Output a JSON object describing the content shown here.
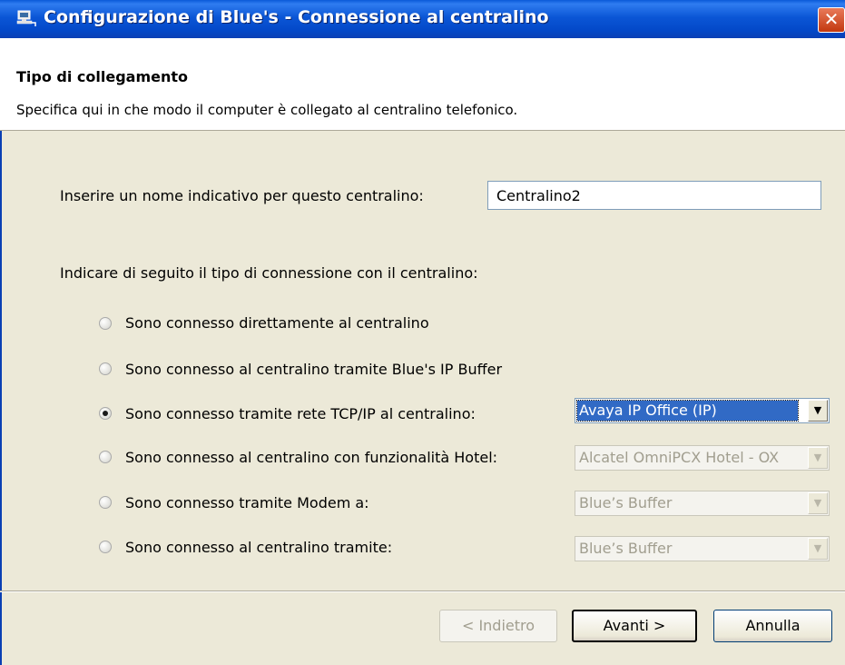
{
  "window": {
    "title": "Configurazione di Blue's - Connessione al centralino",
    "close_glyph": "✕",
    "icon": "computer-network-icon"
  },
  "header": {
    "title": "Tipo di collegamento",
    "subtitle": "Specifica qui in che modo il computer è collegato al centralino telefonico."
  },
  "form": {
    "name_label": "Inserire un nome indicativo per questo centralino:",
    "name_value": "Centralino2",
    "connection_label": "Indicare di seguito il tipo di connessione con il centralino:",
    "options": [
      {
        "label": "Sono connesso direttamente al centralino",
        "checked": false
      },
      {
        "label": "Sono connesso al centralino tramite Blue's IP Buffer",
        "checked": false
      },
      {
        "label": "Sono connesso tramite rete TCP/IP al centralino:",
        "checked": true,
        "combo": "Avaya IP Office (IP)",
        "combo_enabled": true
      },
      {
        "label": "Sono connesso al centralino con funzionalità Hotel:",
        "checked": false,
        "combo": "Alcatel OmniPCX Hotel - OX",
        "combo_enabled": false
      },
      {
        "label": "Sono connesso  tramite Modem a:",
        "checked": false,
        "combo": "Blue’s Buffer",
        "combo_enabled": false
      },
      {
        "label": "Sono connesso al centralino tramite:",
        "checked": false,
        "combo": "Blue’s Buffer",
        "combo_enabled": false
      }
    ],
    "combo_arrow": "▼"
  },
  "buttons": {
    "back": "< Indietro",
    "next": "Avanti >",
    "cancel": "Annulla"
  }
}
